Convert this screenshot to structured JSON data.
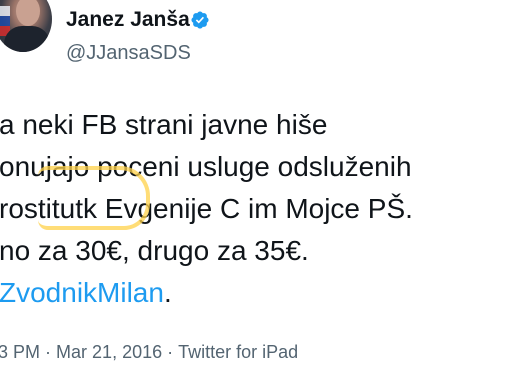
{
  "author": {
    "display_name": "Janez Janša",
    "handle": "@JJansaSDS"
  },
  "tweet": {
    "lines": [
      "a neki FB strani javne hiše",
      "onujajo poceni usluge odsluženih",
      "rostitutk Evgenije C im Mojce PŠ.",
      "no za 30€, drugo za 35€."
    ],
    "mention": "ZvodnikMilan",
    "mention_suffix": "."
  },
  "meta": {
    "time": "3 PM",
    "separator": "·",
    "date": "Mar 21, 2016",
    "source": "Twitter for iPad"
  },
  "colors": {
    "link": "#1d9bf0",
    "secondary_text": "#536471",
    "verified_badge": "#1d9bf0",
    "highlight": "#ffd24a"
  },
  "icons": {
    "verified": "verified-badge-icon"
  }
}
